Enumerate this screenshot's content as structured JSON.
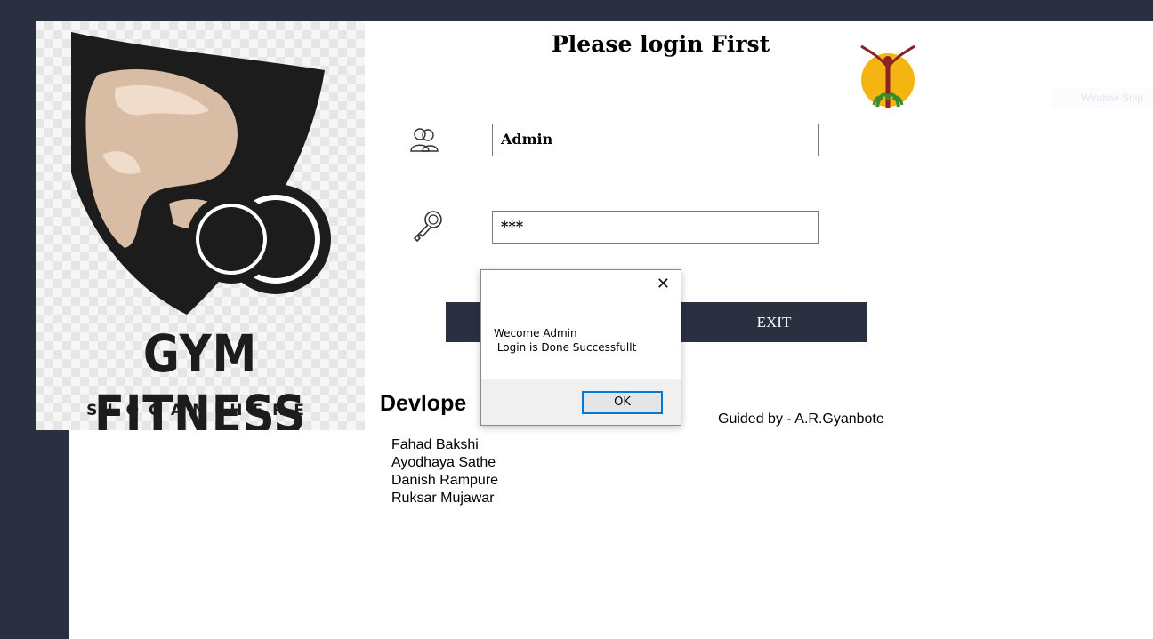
{
  "login": {
    "title": "Please login First",
    "username_value": "Admin",
    "password_value": "***",
    "login_label": "",
    "exit_label": "EXIT"
  },
  "logo": {
    "brand": "GYM FITNESS",
    "slogan": "SLOGAN HERE"
  },
  "footer": {
    "developers_heading": "Devlope",
    "guided_by": "Guided by - A.R.Gyanbote",
    "developers": [
      "Fahad Bakshi",
      "Ayodhaya Sathe",
      "Danish Rampure",
      "Ruksar Mujawar"
    ]
  },
  "dialog": {
    "message": "Wecome Admin\n Login is Done Successfullt",
    "ok_label": "OK"
  },
  "faint_overlay": "Window Snip",
  "icons": {
    "user": "users-icon",
    "password": "key-icon",
    "close": "close-icon"
  },
  "colors": {
    "frame": "#2b3040",
    "button": "#2b3040",
    "dialog_ok_border": "#0078d7"
  }
}
